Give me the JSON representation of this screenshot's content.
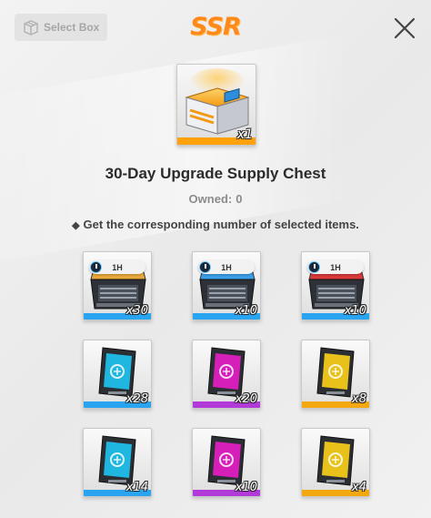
{
  "header": {
    "select_box_label": "Select Box",
    "rarity_label": "SSR",
    "close_icon": "close-icon"
  },
  "chest": {
    "name": "30-Day Upgrade Supply Chest",
    "owned_label": "Owned:",
    "owned_value": "0",
    "quantity": "x1",
    "rarity_color": "#ffa10a"
  },
  "description": "Get the corresponding number of selected items.",
  "items": [
    {
      "kind": "case",
      "badge": "1H",
      "quantity": "x30",
      "accent": "#e8a83a",
      "bar": "#29a4f0"
    },
    {
      "kind": "case",
      "badge": "1H",
      "quantity": "x10",
      "accent": "#3a9ee8",
      "bar": "#29a4f0"
    },
    {
      "kind": "case",
      "badge": "1H",
      "quantity": "x10",
      "accent": "#d83a3a",
      "bar": "#29a4f0"
    },
    {
      "kind": "card",
      "quantity": "x28",
      "accent": "#1fb6e0",
      "bar": "#29a4f0"
    },
    {
      "kind": "card",
      "quantity": "x20",
      "accent": "#d61fb8",
      "bar": "#b23ad8"
    },
    {
      "kind": "card",
      "quantity": "x8",
      "accent": "#e8c21a",
      "bar": "#f2a80e"
    },
    {
      "kind": "card",
      "quantity": "x14",
      "accent": "#1fb6e0",
      "bar": "#29a4f0"
    },
    {
      "kind": "card",
      "quantity": "x10",
      "accent": "#d61fb8",
      "bar": "#b23ad8"
    },
    {
      "kind": "card",
      "quantity": "x4",
      "accent": "#e8c21a",
      "bar": "#f2a80e"
    }
  ]
}
